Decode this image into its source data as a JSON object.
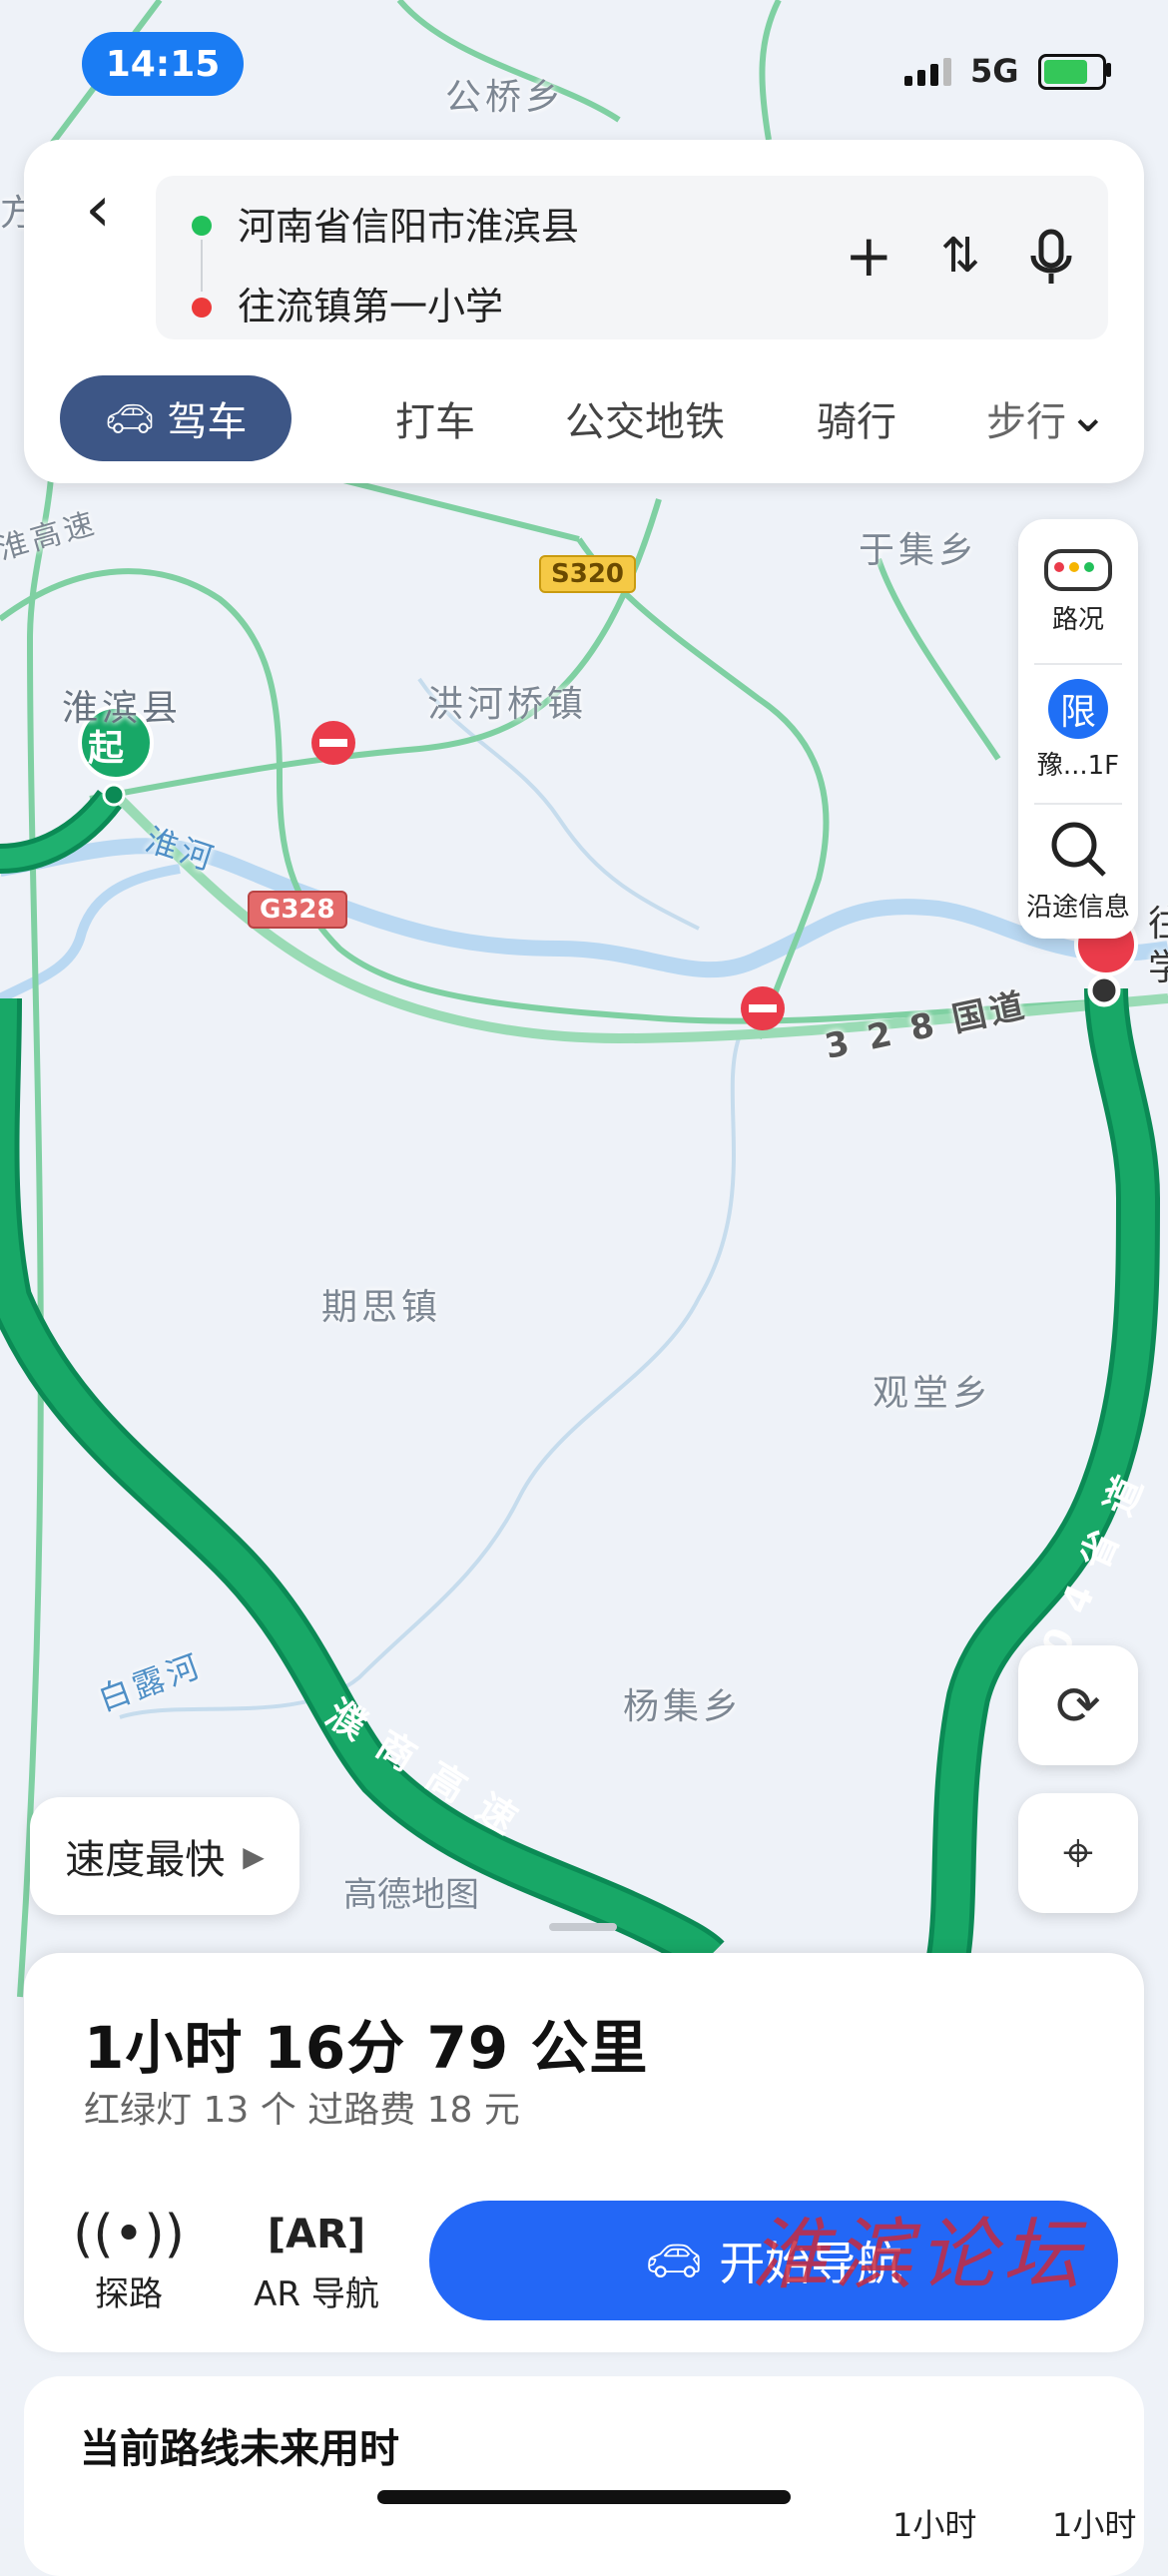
{
  "status_bar": {
    "time": "14:15",
    "network": "5G"
  },
  "route": {
    "from": "河南省信阳市淮滨县",
    "to": "往流镇第一小学",
    "add_icon": "plus-icon",
    "swap_icon": "swap-icon",
    "voice_icon": "mic-icon"
  },
  "tabs": {
    "active": "驾车",
    "items": [
      "打车",
      "公交地铁",
      "骑行",
      "步行"
    ]
  },
  "map": {
    "labels": [
      "公桥乡",
      "于集乡",
      "淮滨县",
      "洪河桥镇",
      "期思镇",
      "观堂乡",
      "杨集乡"
    ],
    "river_labels": [
      "淮河",
      "白露河"
    ],
    "road_labels": [
      "3 2 8 国道",
      "濮 商 高 速",
      "2 0 4 省 道",
      "淮高速"
    ],
    "badges": {
      "s_road": "S320",
      "g_road": "G328"
    },
    "start_marker": "起",
    "brand": "高德地图",
    "edge_partial_left": "方",
    "edge_partial_right": [
      "往",
      "学"
    ]
  },
  "side_panel": {
    "traffic": "路况",
    "restriction_badge": "限",
    "restriction_text": "豫...1F",
    "along_route": "沿途信息"
  },
  "speed_option": "速度最快",
  "summary": {
    "eta": "1小时 16分  79 公里",
    "lights_and_toll": "红绿灯 13 个   过路费 18 元"
  },
  "actions": {
    "explore": "探路",
    "ar_nav": "AR 导航",
    "start_nav": "开始导航"
  },
  "watermark": "淮滨论坛",
  "future": {
    "title": "当前路线未来用时",
    "labels": [
      "1小时",
      "1小时"
    ]
  }
}
